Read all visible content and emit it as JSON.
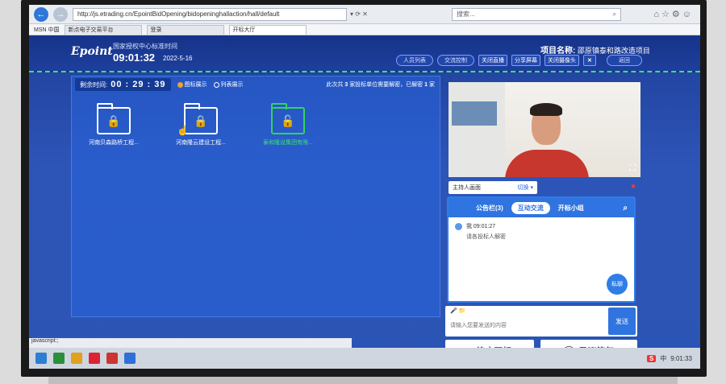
{
  "browser": {
    "url": "http://js.etrading.cn/EpointBidOpening/bidopeninghallaction/hall/default",
    "search_placeholder": "搜索...",
    "favorites": [
      "MSN 中国"
    ],
    "tabs": [
      "新点电子交易平台",
      "登录",
      "开标大厅"
    ],
    "status": "javascript:;"
  },
  "header": {
    "logo": "Epoint",
    "time_label": "国家授权中心标准时间",
    "clock": "09:01:32",
    "date": "2022-5-16",
    "project_label": "项目名称:",
    "project_name": "邵原镇泰和路改造项目",
    "buttons": [
      "人员列表",
      "交流控制",
      "关闭直播",
      "分享屏幕",
      "关闭摄像头",
      "返回"
    ]
  },
  "main": {
    "remain_label": "剩余时间:",
    "remain_value": "00 : 29 : 39",
    "view_icon": "图标展示",
    "view_list": "列表展示",
    "summary_prefix": "此次共",
    "total_count": "3",
    "summary_mid": "家投标单位需要解密，已解密",
    "decrypted_count": "1",
    "summary_suffix": "家",
    "folders": [
      {
        "name": "河南贝森路桥工程...",
        "state": "locked"
      },
      {
        "name": "河南隆云建设工程...",
        "state": "locked"
      },
      {
        "name": "泰和隆设集团有限...",
        "state": "unlocked"
      }
    ]
  },
  "right": {
    "host_select": "主持人画面",
    "switch_label": "切换",
    "chat_tabs": [
      "公告栏(3)",
      "互动交流",
      "开标小组"
    ],
    "message_sender": "我 09:01:27",
    "message_text": "请各投标人解密",
    "private_chat": "私聊",
    "input_placeholder": "请输入您要发送的内容",
    "send": "发送",
    "stop_button": "终止开标",
    "objection_button": "异议答复"
  },
  "taskbar": {
    "ime": "S",
    "lang": "中",
    "time": "9:01:33"
  },
  "colors": {
    "app_bg": "#2b55b4",
    "accent": "#2f74e0",
    "green": "#34d35c"
  }
}
